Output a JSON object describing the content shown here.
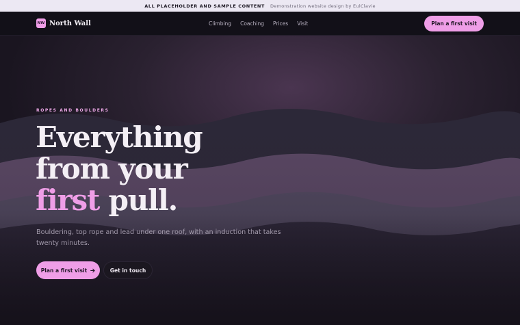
{
  "notice": {
    "label": "ALL PLACEHOLDER AND SAMPLE CONTENT",
    "credit": "Demonstration website design by EulClavie"
  },
  "header": {
    "logo_text": "NW",
    "brand": "North Wall",
    "nav": [
      "Climbing",
      "Coaching",
      "Prices",
      "Visit"
    ],
    "cta": "Plan a first visit"
  },
  "hero": {
    "eyebrow": "ROPES AND BOULDERS",
    "headline_line1": "Everything",
    "headline_line2": "from your",
    "headline_accent": "first",
    "headline_rest": "pull.",
    "subline": "Bouldering, top rope and lead under one roof, with an induction that takes twenty minutes.",
    "primary_cta": "Plan a first visit",
    "primary_icon": "arrow-right-icon",
    "secondary_cta": "Get in touch"
  },
  "colors": {
    "accent": "#ef9ee7",
    "background": "#16121c",
    "notice_bar": "#ece8f3"
  }
}
